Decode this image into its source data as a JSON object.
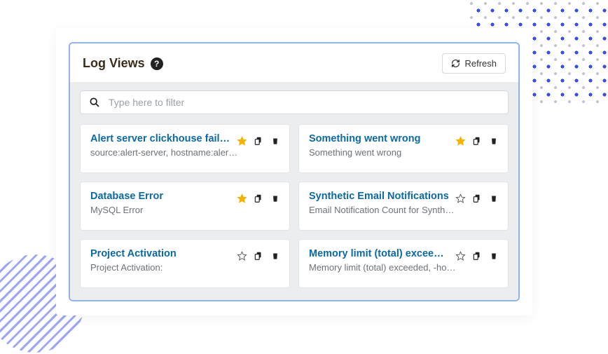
{
  "header": {
    "title": "Log Views",
    "refresh_label": "Refresh"
  },
  "search": {
    "placeholder": "Type here to filter"
  },
  "cards": [
    {
      "title": "Alert server clickhouse failure",
      "subtitle": "source:alert-server, hostname:aler…",
      "starred": true
    },
    {
      "title": "Something went wrong",
      "subtitle": "Something went wrong",
      "starred": true
    },
    {
      "title": "Database Error",
      "subtitle": "MySQL Error",
      "starred": true
    },
    {
      "title": "Synthetic Email Notifications",
      "subtitle": "Email Notification Count for Synth…",
      "starred": false
    },
    {
      "title": "Project Activation",
      "subtitle": "Project Activation:",
      "starred": false
    },
    {
      "title": "Memory limit (total) exceeded",
      "subtitle": "Memory limit (total) exceeded, -ho…",
      "starred": false
    }
  ]
}
